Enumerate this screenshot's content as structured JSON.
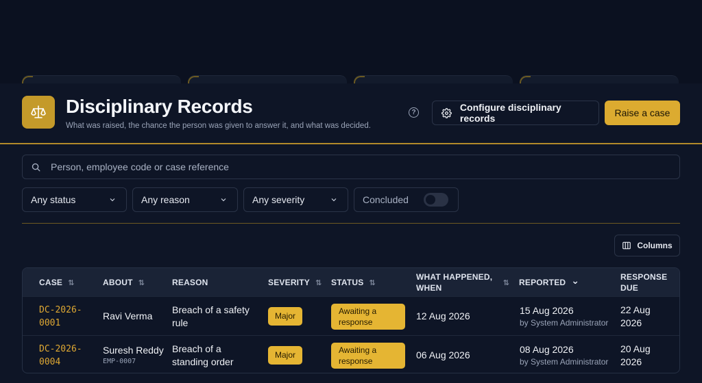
{
  "header": {
    "title": "Disciplinary Records",
    "subtitle": "What was raised, the chance the person was given to answer it, and what was decided.",
    "help_label": "?",
    "configure_label": "Configure disciplinary records",
    "raise_label": "Raise a case"
  },
  "icons": {
    "logo": "scales-icon",
    "help": "help-circle-icon",
    "configure": "gear-icon",
    "search": "search-icon",
    "chevron": "chevron-down-icon",
    "columns": "columns-icon",
    "sort": "sort-icon"
  },
  "colors": {
    "accent": "#dcab30",
    "background": "#0b1120",
    "badge": "#e5b533"
  },
  "search": {
    "placeholder": "Person, employee code or case reference"
  },
  "filters": {
    "status": "Any status",
    "reason": "Any reason",
    "severity": "Any severity",
    "concluded": "Concluded",
    "concluded_on": false
  },
  "columns_button": "Columns",
  "table": {
    "headers": {
      "case": "CASE",
      "about": "ABOUT",
      "reason": "REASON",
      "severity": "SEVERITY",
      "status": "STATUS",
      "what_happened_1": "WHAT HAPPENED,",
      "what_happened_2": "WHEN",
      "reported": "REPORTED",
      "response_due_1": "RESPONSE",
      "response_due_2": "DUE"
    },
    "sort_glyph": "⇅",
    "sort_active_glyph": "⌄",
    "rows": [
      {
        "case_1": "DC-2026-",
        "case_2": "0001",
        "about": "Ravi Verma",
        "emp_code": "",
        "reason_1": "Breach of a safety",
        "reason_2": "rule",
        "severity": "Major",
        "status_1": "Awaiting a",
        "status_2": "response",
        "when": "12 Aug 2026",
        "reported": "15 Aug 2026",
        "reported_by": "by System Administrator",
        "due_1": "22 Aug",
        "due_2": "2026"
      },
      {
        "case_1": "DC-2026-",
        "case_2": "0004",
        "about": "Suresh Reddy",
        "emp_code": "EMP-0007",
        "reason_1": "Breach of a",
        "reason_2": "standing order",
        "severity": "Major",
        "status_1": "Awaiting a",
        "status_2": "response",
        "when": "06 Aug 2026",
        "reported": "08 Aug 2026",
        "reported_by": "by System Administrator",
        "due_1": "20 Aug",
        "due_2": "2026"
      }
    ]
  }
}
